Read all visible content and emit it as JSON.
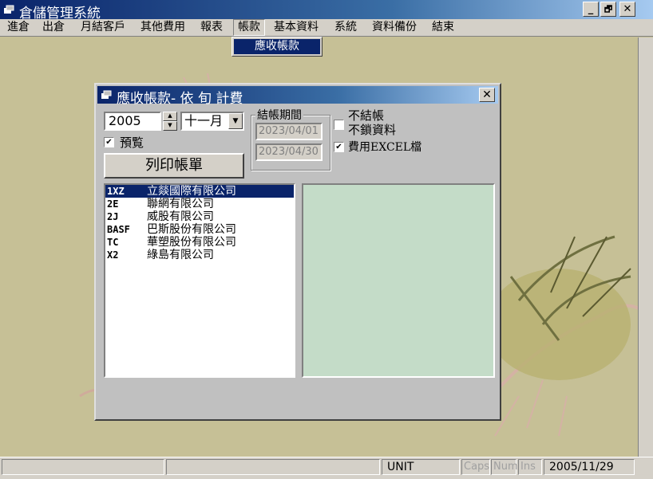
{
  "window": {
    "title": "倉儲管理系統",
    "min": "_",
    "max": "🗗",
    "close": "✕"
  },
  "menu": [
    "進倉",
    "出倉",
    "月結客戶",
    "其他費用",
    "報表",
    "帳款",
    "基本資料",
    "系統",
    "資料備份",
    "結束"
  ],
  "dropdown": {
    "item": "應收帳款"
  },
  "dialog": {
    "title": "應收帳款- 依 旬 計費",
    "close": "✕",
    "year": "2005",
    "month": "十一月",
    "preview_label": "預覧",
    "preview_checked": "✔",
    "print_button": "列印帳單",
    "period_title": "結帳期間",
    "date_from": "2023/04/01",
    "date_to": "2023/04/30",
    "opt_nosettle": "不結帳",
    "opt_nolock": "不鎖資料",
    "opt_excel": "費用EXCEL檔",
    "opt_excel_checked": "✔",
    "customers": [
      {
        "code": "1XZ",
        "name": "立燚國際有限公司"
      },
      {
        "code": "2E",
        "name": "聯網有限公司"
      },
      {
        "code": "2J",
        "name": "威股有限公司"
      },
      {
        "code": "BASF",
        "name": "巴斯股份有限公司"
      },
      {
        "code": "TC",
        "name": "華塑股份有限公司"
      },
      {
        "code": "X2",
        "name": "綠島有限公司"
      }
    ]
  },
  "status": {
    "unit": "UNIT",
    "caps": "Caps",
    "num": "Num",
    "ins": "Ins",
    "date": "2005/11/29"
  },
  "colors": {
    "titlebar": "#0a246a",
    "panel": "#c4dcc8",
    "desktop": "#c6c096"
  }
}
